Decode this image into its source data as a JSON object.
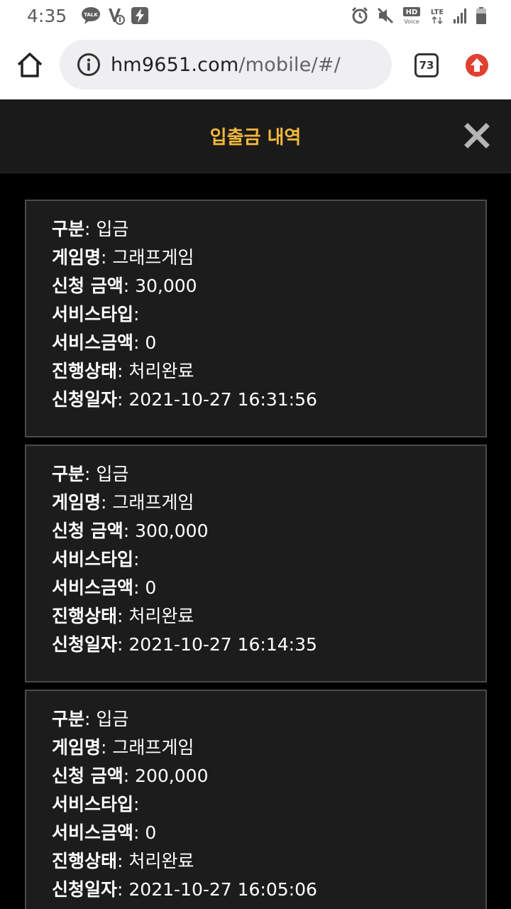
{
  "status_bar": {
    "time": "4:35",
    "talk_badge": "TALK",
    "hd_label": "HD",
    "voice_label": "Voice",
    "lte_label": "LTE"
  },
  "browser": {
    "url_domain": "hm9651.com",
    "url_path": "/mobile/#/",
    "tab_count": "73"
  },
  "page": {
    "title": "입출금 내역"
  },
  "labels": {
    "type": "구분",
    "game": "게임명",
    "amount": "신청 금액",
    "service_type": "서비스타입",
    "service_amount": "서비스금액",
    "status": "진행상태",
    "date": "신청일자",
    "sep": ": "
  },
  "records": [
    {
      "type": "입금",
      "game": "그래프게임",
      "amount": "30,000",
      "service_type": "",
      "service_amount": "0",
      "status": "처리완료",
      "date": "2021-10-27 16:31:56"
    },
    {
      "type": "입금",
      "game": "그래프게임",
      "amount": "300,000",
      "service_type": "",
      "service_amount": "0",
      "status": "처리완료",
      "date": "2021-10-27 16:14:35"
    },
    {
      "type": "입금",
      "game": "그래프게임",
      "amount": "200,000",
      "service_type": "",
      "service_amount": "0",
      "status": "처리완료",
      "date": "2021-10-27 16:05:06"
    }
  ],
  "colors": {
    "accent": "#f2b83a",
    "card_bg": "#1c1c1c",
    "card_border": "#4a4a4a",
    "page_bg": "#000000",
    "header_bg": "#1a1a1a",
    "update_red": "#e0402f"
  }
}
